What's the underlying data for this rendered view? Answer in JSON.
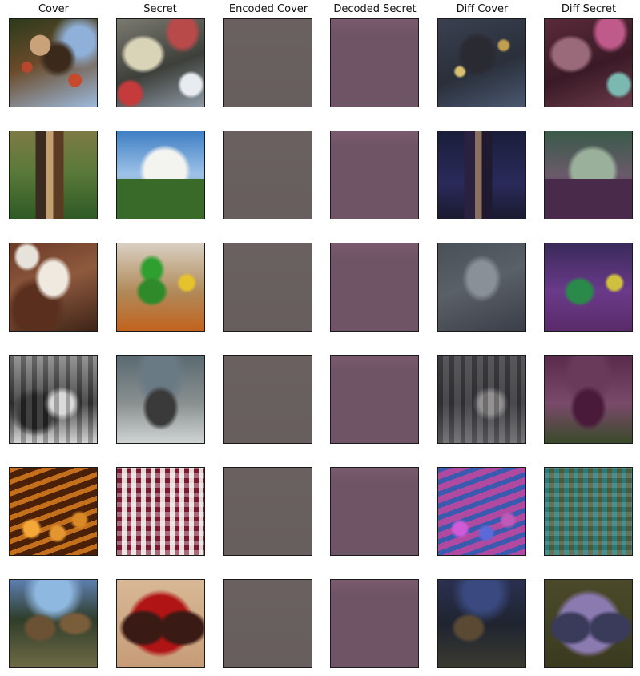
{
  "columns": [
    {
      "title": "Cover"
    },
    {
      "title": "Secret"
    },
    {
      "title": "Encoded Cover"
    },
    {
      "title": "Decoded Secret"
    },
    {
      "title": "Diff Cover"
    },
    {
      "title": "Diff Secret"
    }
  ],
  "rows": [
    {
      "cover": "bird on branch with red berries against blue sky",
      "secret": "bowl of pasta with cup on table",
      "diff_cover": "dark bird silhouette with yellow artifacts",
      "diff_secret": "pink/red tinted table scene"
    },
    {
      "cover": "wooden tree trunk close-up on green background",
      "secret": "white delivery truck on grass under blue sky",
      "diff_cover": "dark blue trunk silhouette",
      "diff_secret": "pink-green tinted delivery truck"
    },
    {
      "cover": "brown and white cow with horns",
      "secret": "green bottle on wooden table with yellow toy bus",
      "diff_cover": "grey-blue cow outline",
      "diff_secret": "purple-green tinted bottle scene"
    },
    {
      "cover": "black and white vintage barbershop photo",
      "secret": "grey gadget with display and rainbow logo",
      "diff_cover": "grey barbershop outline",
      "diff_secret": "purple tinted gadget"
    },
    {
      "cover": "orange glowing rows of balls close-up",
      "secret": "red and white checkered cloth with figure",
      "diff_cover": "blue and magenta dotted pattern",
      "diff_secret": "teal-green tinted checkered cloth"
    },
    {
      "cover": "ibex goats standing in forest",
      "secret": "red sunglasses on beige background",
      "diff_cover": "dark goat silhouette with blue artifacts",
      "diff_secret": "purple sunglasses outline on olive background"
    }
  ]
}
